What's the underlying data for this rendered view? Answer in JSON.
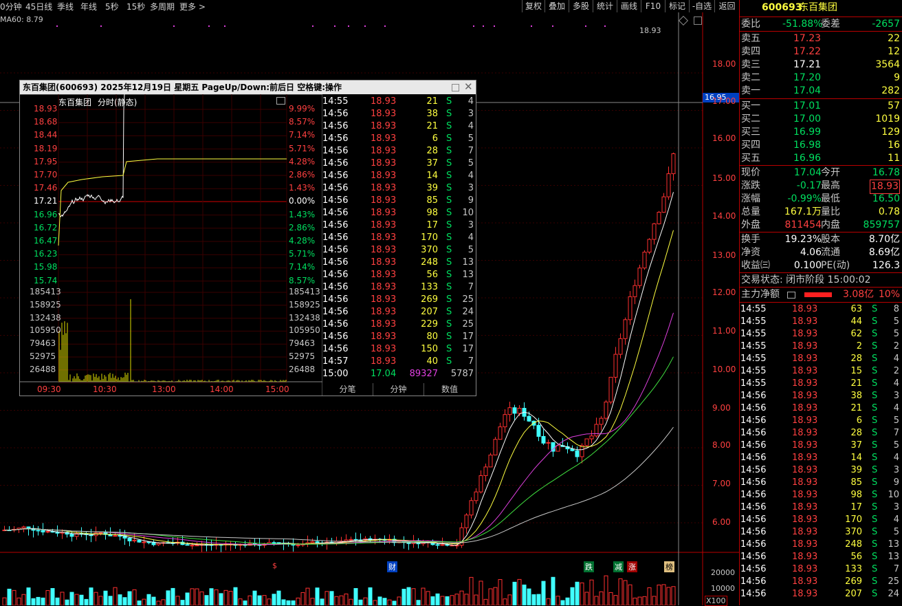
{
  "toolbar": {
    "periods": [
      "0分钟",
      "45日线",
      "季线",
      "年线",
      "5秒",
      "15秒",
      "多周期",
      "更多 >"
    ],
    "right_buttons": [
      "复权",
      "叠加",
      "多股",
      "统计",
      "画线",
      "F10",
      "标记",
      "-自选",
      "返回"
    ]
  },
  "chart": {
    "ma_label": "MA60: 8.79",
    "price_axis": [
      "18.00",
      "17.00",
      "16.00",
      "15.00",
      "14.00",
      "13.00",
      "12.00",
      "11.00",
      "10.00",
      "9.00",
      "8.00",
      "7.00",
      "6.00"
    ],
    "current_price_tag": "16.95",
    "peak_label": "18.93",
    "vol_axis": [
      "20000",
      "10000"
    ],
    "vol_unit": "X100",
    "event_markers": [
      "$",
      "财",
      "跌",
      "减",
      "涨",
      "榜"
    ]
  },
  "quote": {
    "code": "600693",
    "name": "东百集团",
    "weibi_label": "委比",
    "weibi_value": "-51.88%",
    "weicha_label": "委差",
    "weicha_value": "-2657",
    "asks": [
      {
        "label": "卖五",
        "price": "17.23",
        "vol": "22"
      },
      {
        "label": "卖四",
        "price": "17.22",
        "vol": "12"
      },
      {
        "label": "卖三",
        "price": "17.21",
        "vol": "3564"
      },
      {
        "label": "卖二",
        "price": "17.20",
        "vol": "9"
      },
      {
        "label": "卖一",
        "price": "17.04",
        "vol": "282"
      }
    ],
    "bids": [
      {
        "label": "买一",
        "price": "17.01",
        "vol": "57"
      },
      {
        "label": "买二",
        "price": "17.00",
        "vol": "1019"
      },
      {
        "label": "买三",
        "price": "16.99",
        "vol": "129"
      },
      {
        "label": "买四",
        "price": "16.98",
        "vol": "16"
      },
      {
        "label": "买五",
        "price": "16.96",
        "vol": "11"
      }
    ],
    "stats": [
      {
        "l1": "现价",
        "v1": "17.04",
        "l2": "今开",
        "v2": "16.78"
      },
      {
        "l1": "涨跌",
        "v1": "-0.17",
        "l2": "最高",
        "v2": "18.93"
      },
      {
        "l1": "涨幅",
        "v1": "-0.99%",
        "l2": "最低",
        "v2": "16.50"
      },
      {
        "l1": "总量",
        "v1": "167.1万",
        "l2": "量比",
        "v2": "0.78"
      },
      {
        "l1": "外盘",
        "v1": "811454",
        "l2": "内盘",
        "v2": "859757"
      }
    ],
    "stats2": [
      {
        "l1": "换手",
        "v1": "19.23%",
        "l2": "股本",
        "v2": "8.70亿"
      },
      {
        "l1": "净资",
        "v1": "4.06",
        "l2": "流通",
        "v2": "8.69亿"
      },
      {
        "l1": "收益㈢",
        "v1": "0.100",
        "l2": "PE(动)",
        "v2": "126.3"
      }
    ],
    "trade_status": "交易状态: 闭市阶段 15:00:02",
    "main_flow_label": "主力净额",
    "main_flow_value": "3.08亿",
    "main_flow_pct": "10%",
    "ticks": [
      [
        "14:55",
        "18.93",
        "63",
        "S",
        "8"
      ],
      [
        "14:55",
        "18.93",
        "44",
        "S",
        "5"
      ],
      [
        "14:55",
        "18.93",
        "62",
        "S",
        "5"
      ],
      [
        "14:55",
        "18.93",
        "2",
        "S",
        "2"
      ],
      [
        "14:55",
        "18.93",
        "28",
        "S",
        "4"
      ],
      [
        "14:55",
        "18.93",
        "15",
        "S",
        "2"
      ],
      [
        "14:55",
        "18.93",
        "21",
        "S",
        "4"
      ],
      [
        "14:56",
        "18.93",
        "38",
        "S",
        "3"
      ],
      [
        "14:56",
        "18.93",
        "21",
        "S",
        "4"
      ],
      [
        "14:56",
        "18.93",
        "6",
        "S",
        "5"
      ],
      [
        "14:56",
        "18.93",
        "28",
        "S",
        "7"
      ],
      [
        "14:56",
        "18.93",
        "37",
        "S",
        "5"
      ],
      [
        "14:56",
        "18.93",
        "14",
        "S",
        "4"
      ],
      [
        "14:56",
        "18.93",
        "39",
        "S",
        "3"
      ],
      [
        "14:56",
        "18.93",
        "85",
        "S",
        "9"
      ],
      [
        "14:56",
        "18.93",
        "98",
        "S",
        "10"
      ],
      [
        "14:56",
        "18.93",
        "17",
        "S",
        "3"
      ],
      [
        "14:56",
        "18.93",
        "170",
        "S",
        "4"
      ],
      [
        "14:56",
        "18.93",
        "370",
        "S",
        "5"
      ],
      [
        "14:56",
        "18.93",
        "248",
        "S",
        "13"
      ],
      [
        "14:56",
        "18.93",
        "56",
        "S",
        "13"
      ],
      [
        "14:56",
        "18.93",
        "133",
        "S",
        "7"
      ],
      [
        "14:56",
        "18.93",
        "269",
        "S",
        "25"
      ],
      [
        "14:56",
        "18.93",
        "207",
        "S",
        "24"
      ]
    ]
  },
  "popup": {
    "title": "东百集团(600693)  2025年12月19日 星期五 PageUp/Down:前后日 空格键:操作",
    "subtitle_name": "东百集团",
    "subtitle_mode": "分时(静态)",
    "left_axis": [
      "18.93",
      "18.68",
      "18.44",
      "18.19",
      "17.95",
      "17.70",
      "17.46",
      "17.21",
      "16.96",
      "16.72",
      "16.47",
      "16.23",
      "15.98",
      "15.74"
    ],
    "right_axis": [
      "9.99%",
      "8.57%",
      "7.14%",
      "5.71%",
      "4.28%",
      "2.86%",
      "1.43%",
      "0.00%",
      "1.43%",
      "2.86%",
      "4.28%",
      "5.71%",
      "7.14%",
      "8.57%"
    ],
    "vol_axis": [
      "185413",
      "158925",
      "132438",
      "105950",
      "79463",
      "52975",
      "26488"
    ],
    "time_axis": [
      "09:30",
      "10:30",
      "13:00",
      "14:00",
      "15:00"
    ],
    "ticks": [
      [
        "14:55",
        "18.93",
        "21",
        "S",
        "4"
      ],
      [
        "14:56",
        "18.93",
        "38",
        "S",
        "3"
      ],
      [
        "14:56",
        "18.93",
        "21",
        "S",
        "4"
      ],
      [
        "14:56",
        "18.93",
        "6",
        "S",
        "5"
      ],
      [
        "14:56",
        "18.93",
        "28",
        "S",
        "7"
      ],
      [
        "14:56",
        "18.93",
        "37",
        "S",
        "5"
      ],
      [
        "14:56",
        "18.93",
        "14",
        "S",
        "4"
      ],
      [
        "14:56",
        "18.93",
        "39",
        "S",
        "3"
      ],
      [
        "14:56",
        "18.93",
        "85",
        "S",
        "9"
      ],
      [
        "14:56",
        "18.93",
        "98",
        "S",
        "10"
      ],
      [
        "14:56",
        "18.93",
        "17",
        "S",
        "3"
      ],
      [
        "14:56",
        "18.93",
        "170",
        "S",
        "4"
      ],
      [
        "14:56",
        "18.93",
        "370",
        "S",
        "5"
      ],
      [
        "14:56",
        "18.93",
        "248",
        "S",
        "13"
      ],
      [
        "14:56",
        "18.93",
        "56",
        "S",
        "13"
      ],
      [
        "14:56",
        "18.93",
        "133",
        "S",
        "7"
      ],
      [
        "14:56",
        "18.93",
        "269",
        "S",
        "25"
      ],
      [
        "14:56",
        "18.93",
        "207",
        "S",
        "24"
      ],
      [
        "14:56",
        "18.93",
        "229",
        "S",
        "25"
      ],
      [
        "14:56",
        "18.93",
        "80",
        "S",
        "17"
      ],
      [
        "14:56",
        "18.93",
        "150",
        "S",
        "17"
      ],
      [
        "14:57",
        "18.93",
        "40",
        "S",
        "7"
      ]
    ],
    "last_tick": [
      "15:00",
      "17.04",
      "89327",
      "",
      "5787"
    ],
    "footer": [
      "分笔",
      "分钟",
      "数值"
    ]
  }
}
